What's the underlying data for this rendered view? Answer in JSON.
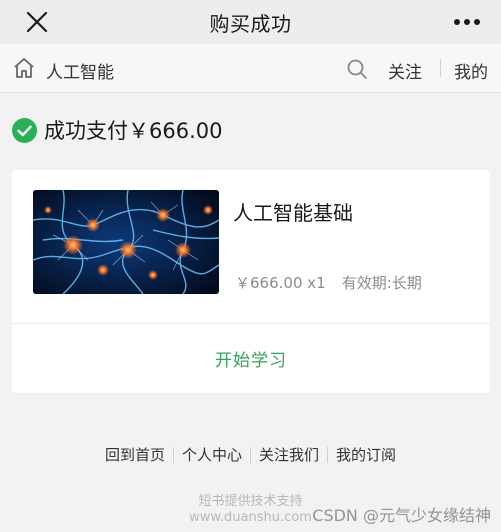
{
  "titlebar": {
    "title": "购买成功",
    "close_icon": "close-icon",
    "more_icon": "more-dots-icon"
  },
  "nav": {
    "breadcrumb": "人工智能",
    "home_icon": "home-icon",
    "search_icon": "search-icon",
    "follow_label": "关注",
    "mine_label": "我的"
  },
  "success": {
    "icon": "check-circle-icon",
    "icon_color": "#2bb05a",
    "text": "成功支付￥666.00"
  },
  "course": {
    "title": "人工智能基础",
    "price": "￥666.00 x1",
    "validity": "有效期:长期",
    "start_label": "开始学习",
    "accent_color": "#31a35b"
  },
  "footer": {
    "links": [
      "回到首页",
      "个人中心",
      "关注我们",
      "我的订阅"
    ],
    "powered_line1": "短书提供技术支持",
    "powered_line2": "www.duanshu.com"
  },
  "watermark": "CSDN @元气少女缘结神"
}
